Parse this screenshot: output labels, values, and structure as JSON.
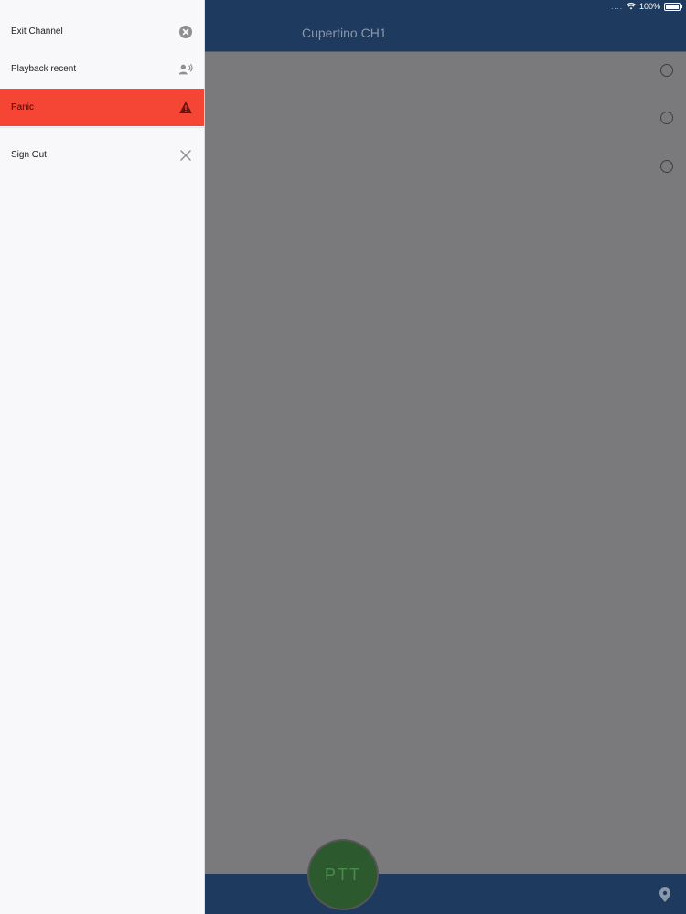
{
  "status_bar": {
    "signal_dots": "....",
    "battery_percent": "100%"
  },
  "nav": {
    "title": "Cupertino CH1"
  },
  "channel_list": {
    "radios": [
      {
        "selected": false
      },
      {
        "selected": false
      },
      {
        "selected": false
      }
    ]
  },
  "ptt": {
    "label": "PTT"
  },
  "drawer": {
    "items": [
      {
        "label": "Exit Channel",
        "icon": "close-circle-icon"
      },
      {
        "label": "Playback recent",
        "icon": "speaker-person-icon"
      },
      {
        "label": "Panic",
        "icon": "warning-icon"
      },
      {
        "label": "Sign Out",
        "icon": "close-icon"
      }
    ]
  },
  "colors": {
    "nav_bg": "#1e3a5f",
    "panic_bg": "#f54535",
    "ptt_bg": "#2c5a2e",
    "overlay_bg": "#7a797b"
  }
}
